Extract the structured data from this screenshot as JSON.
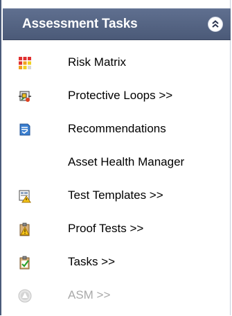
{
  "panel": {
    "title": "Assessment Tasks",
    "collapse_icon": "double-chevron-up-icon"
  },
  "items": [
    {
      "label": "Risk Matrix",
      "icon": "grid-matrix-icon",
      "enabled": true
    },
    {
      "label": "Protective Loops >>",
      "icon": "loop-diagram-icon",
      "enabled": true
    },
    {
      "label": "Recommendations",
      "icon": "recommendation-doc-icon",
      "enabled": true
    },
    {
      "label": "Asset Health Manager",
      "icon": "",
      "enabled": true
    },
    {
      "label": "Test Templates >>",
      "icon": "template-warning-icon",
      "enabled": true
    },
    {
      "label": "Proof Tests >>",
      "icon": "clipboard-warning-icon",
      "enabled": true
    },
    {
      "label": "Tasks >>",
      "icon": "clipboard-check-icon",
      "enabled": true
    },
    {
      "label": "ASM >>",
      "icon": "asm-circle-icon",
      "enabled": false
    }
  ],
  "colors": {
    "header_bg": "#4b5a78",
    "disabled_text": "#a9a9a9"
  }
}
